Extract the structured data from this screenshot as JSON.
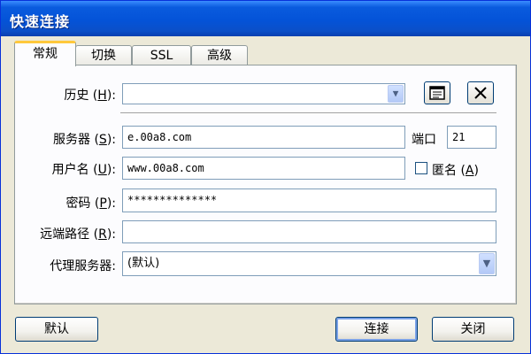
{
  "window": {
    "title": "快速连接"
  },
  "tabs": [
    {
      "label": "常规",
      "active": true
    },
    {
      "label": "切换",
      "active": false
    },
    {
      "label": "SSL",
      "active": false
    },
    {
      "label": "高级",
      "active": false
    }
  ],
  "history": {
    "label": "历史",
    "hotkey": "H",
    "value": ""
  },
  "history_buttons": {
    "book_icon": "address-book-icon",
    "delete_icon": "x-icon"
  },
  "server": {
    "label": "服务器",
    "hotkey": "S",
    "value": "e.00a8.com"
  },
  "port": {
    "label": "端口",
    "value": "21"
  },
  "username": {
    "label": "用户名",
    "hotkey": "U",
    "value": "www.00a8.com"
  },
  "anonymous": {
    "label": "匿名",
    "hotkey": "A",
    "checked": false
  },
  "password": {
    "label": "密码",
    "hotkey": "P",
    "value": "**************"
  },
  "remote_path": {
    "label": "远端路径",
    "hotkey": "R",
    "value": ""
  },
  "proxy": {
    "label": "代理服务器",
    "value": "(默认)"
  },
  "buttons": {
    "default": "默认",
    "connect": "连接",
    "close": "关闭"
  },
  "colors": {
    "titlebar": "#0a5bde",
    "dialog_bg": "#ece9d8",
    "tab_highlight": "#ffc83c",
    "field_border": "#7f9db9"
  }
}
